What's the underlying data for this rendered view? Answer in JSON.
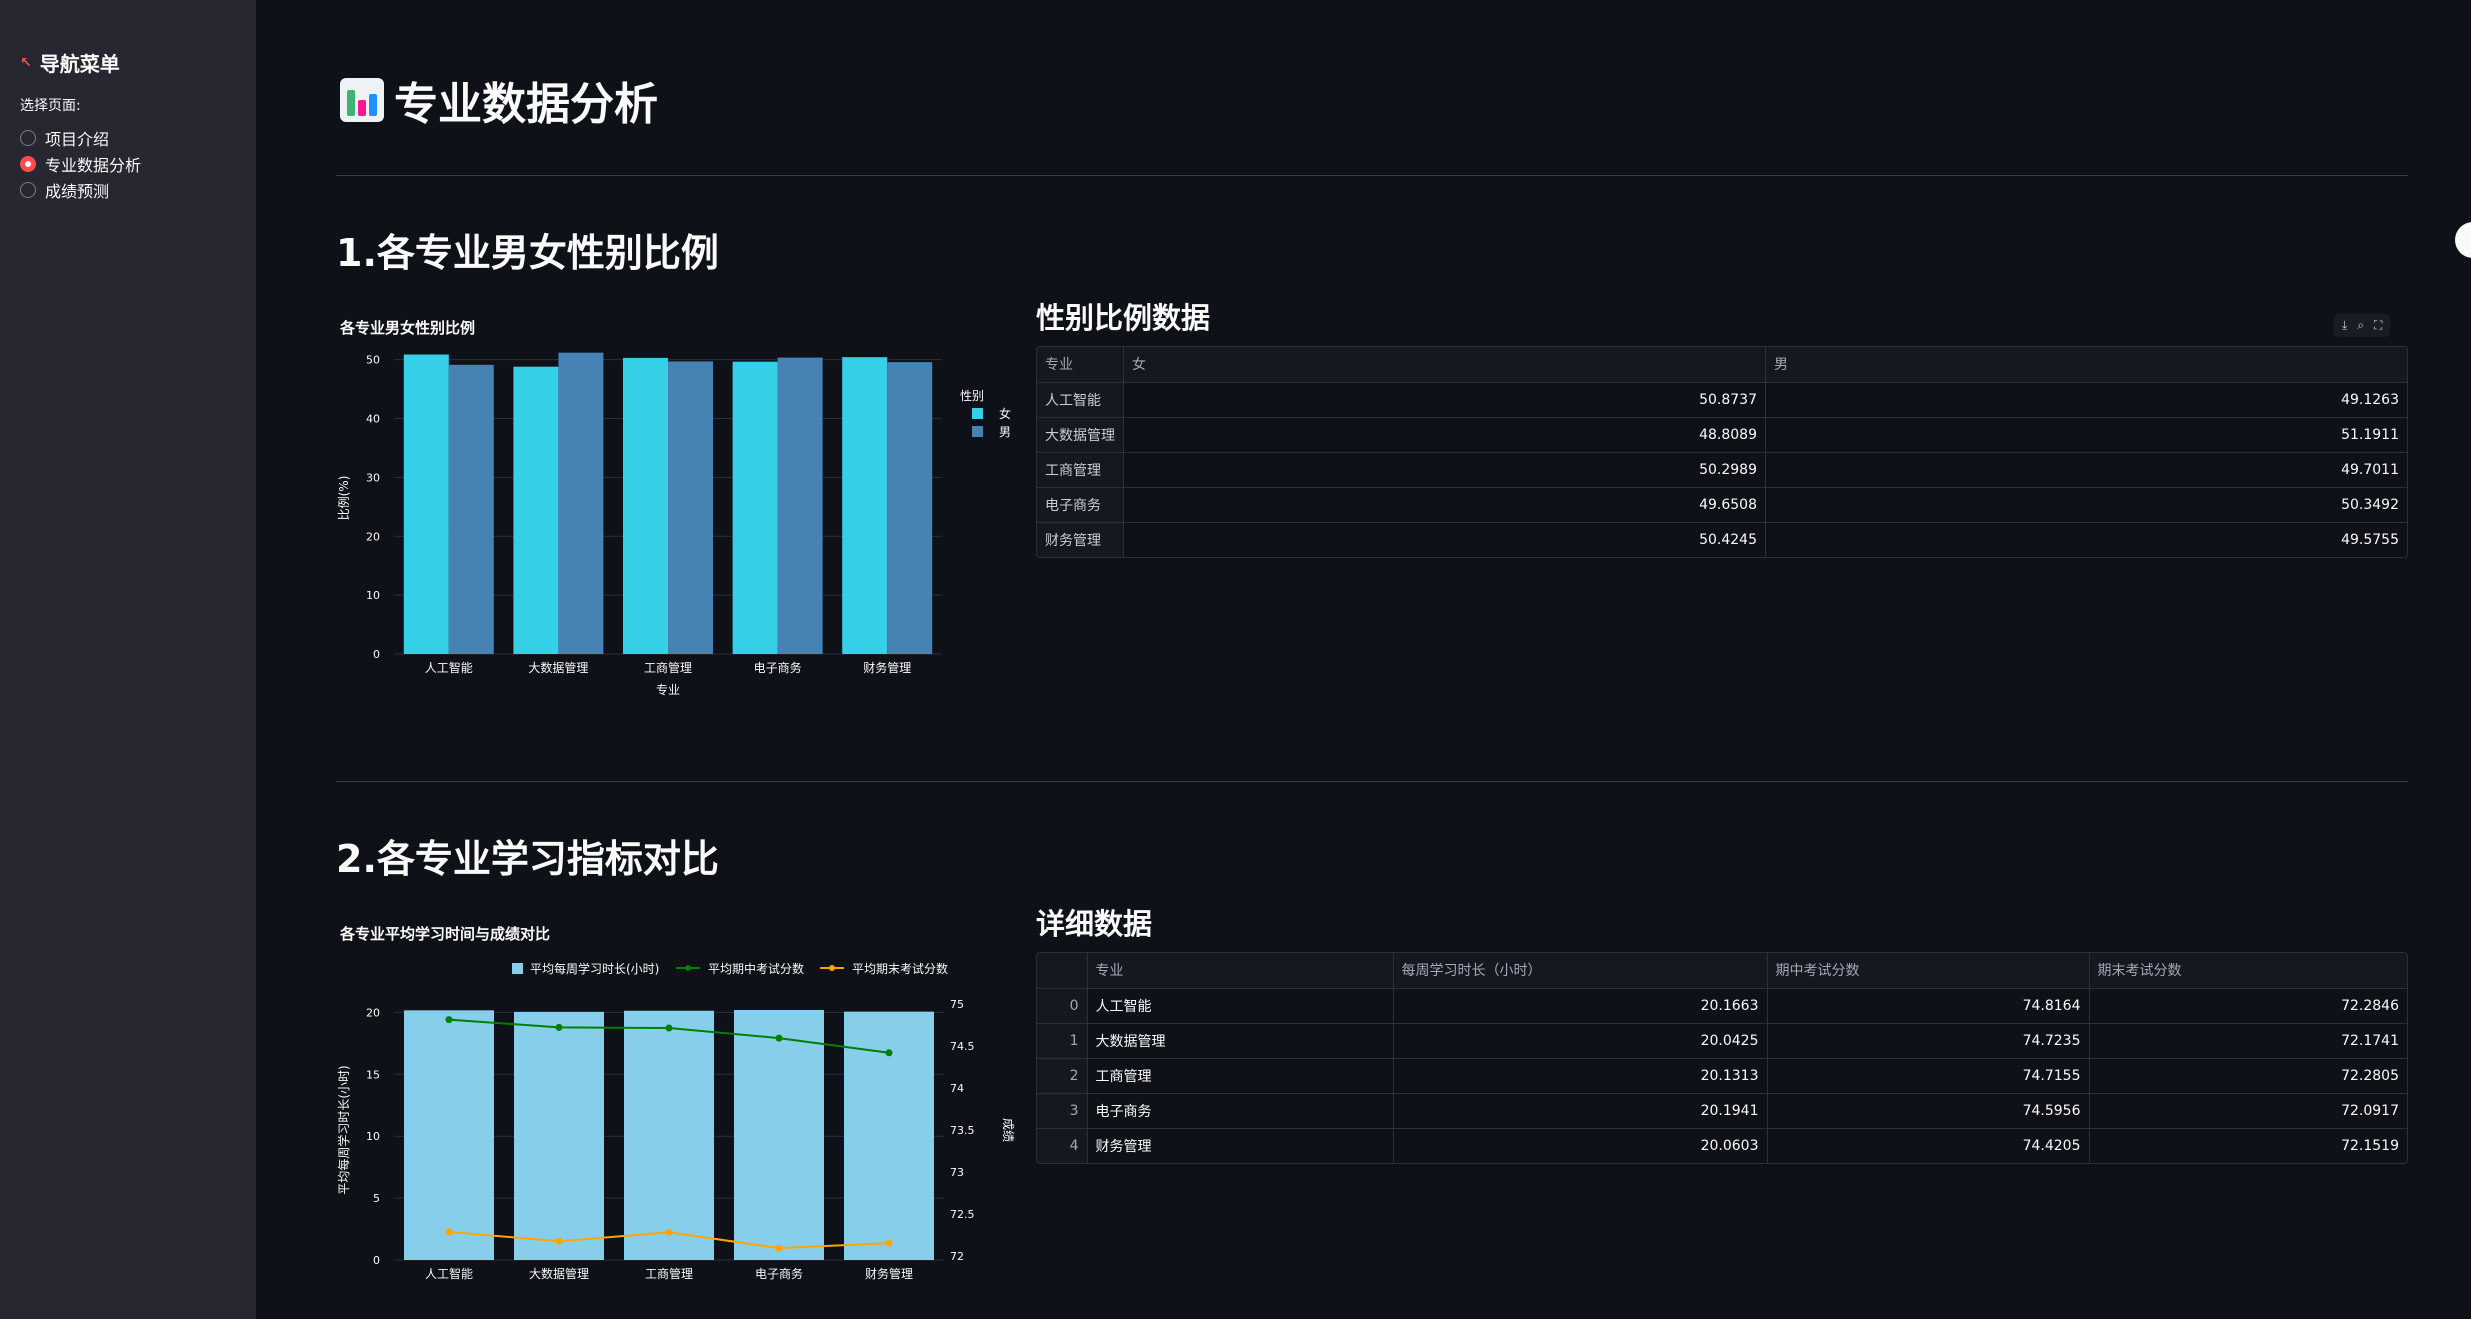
{
  "sidebar": {
    "title": "导航菜单",
    "icon": "pointer-icon",
    "radio_label": "选择页面:",
    "items": [
      {
        "label": "项目介绍",
        "selected": false
      },
      {
        "label": "专业数据分析",
        "selected": true
      },
      {
        "label": "成绩预测",
        "selected": false
      }
    ]
  },
  "page": {
    "title": "专业数据分析",
    "title_icon": "bar-chart-icon"
  },
  "section1": {
    "heading": "1.各专业男女性别比例",
    "table_heading": "性别比例数据",
    "table": {
      "columns": [
        "专业",
        "女",
        "男"
      ],
      "rows": [
        [
          "人工智能",
          "50.8737",
          "49.1263"
        ],
        [
          "大数据管理",
          "48.8089",
          "51.1911"
        ],
        [
          "工商管理",
          "50.2989",
          "49.7011"
        ],
        [
          "电子商务",
          "49.6508",
          "50.3492"
        ],
        [
          "财务管理",
          "50.4245",
          "49.5755"
        ]
      ]
    }
  },
  "section2": {
    "heading": "2.各专业学习指标对比",
    "table_heading": "详细数据",
    "table": {
      "columns": [
        "",
        "专业",
        "每周学习时长（小时）",
        "期中考试分数",
        "期末考试分数"
      ],
      "rows": [
        [
          "0",
          "人工智能",
          "20.1663",
          "74.8164",
          "72.2846"
        ],
        [
          "1",
          "大数据管理",
          "20.0425",
          "74.7235",
          "72.1741"
        ],
        [
          "2",
          "工商管理",
          "20.1313",
          "74.7155",
          "72.2805"
        ],
        [
          "3",
          "电子商务",
          "20.1941",
          "74.5956",
          "72.0917"
        ],
        [
          "4",
          "财务管理",
          "20.0603",
          "74.4205",
          "72.1519"
        ]
      ]
    }
  },
  "toolbar": {
    "icons": [
      "download-icon",
      "search-icon",
      "fullscreen-icon"
    ]
  },
  "colors": {
    "female": "#35cfe8",
    "male": "#4682b4",
    "hours": "#87ceeb",
    "midterm": "#008000",
    "final": "#ffa500",
    "accent": "#ff4b4b"
  },
  "chart_data": [
    {
      "type": "bar",
      "title": "各专业男女性别比例",
      "xlabel": "专业",
      "ylabel": "比例(%)",
      "ylim": [
        0,
        53
      ],
      "yticks": [
        0,
        10,
        20,
        30,
        40,
        50
      ],
      "legend_title": "性别",
      "legend_position": "top-right",
      "categories": [
        "人工智能",
        "大数据管理",
        "工商管理",
        "电子商务",
        "财务管理"
      ],
      "series": [
        {
          "name": "女",
          "values": [
            50.8737,
            48.8089,
            50.2989,
            49.6508,
            50.4245
          ]
        },
        {
          "name": "男",
          "values": [
            49.1263,
            51.1911,
            49.7011,
            50.3492,
            49.5755
          ]
        }
      ]
    },
    {
      "type": "bar",
      "title": "各专业平均学习时间与成绩对比",
      "ylabel": "平均每周学习时长(小时)",
      "y2label": "成绩",
      "ylim": [
        0,
        21
      ],
      "yticks": [
        0,
        5,
        10,
        15,
        20
      ],
      "y2lim": [
        71.95,
        75.05
      ],
      "y2ticks": [
        "72",
        "72.5",
        "73",
        "73.5",
        "74",
        "74.5",
        "75"
      ],
      "legend_position": "top",
      "categories": [
        "人工智能",
        "大数据管理",
        "工商管理",
        "电子商务",
        "财务管理"
      ],
      "series": [
        {
          "name": "平均每周学习时长(小时)",
          "kind": "bar",
          "axis": "y",
          "values": [
            20.1663,
            20.0425,
            20.1313,
            20.1941,
            20.0603
          ]
        },
        {
          "name": "平均期中考试分数",
          "kind": "line",
          "axis": "y2",
          "values": [
            74.8164,
            74.7235,
            74.7155,
            74.5956,
            74.4205
          ]
        },
        {
          "name": "平均期末考试分数",
          "kind": "line",
          "axis": "y2",
          "values": [
            72.2846,
            72.1741,
            72.2805,
            72.0917,
            72.1519
          ]
        }
      ]
    }
  ]
}
